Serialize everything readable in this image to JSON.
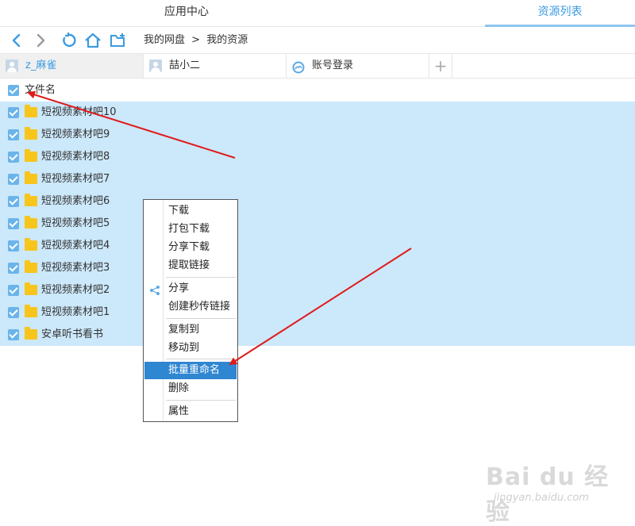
{
  "top_tabs": [
    "应用中心",
    "资源列表"
  ],
  "breadcrumb": {
    "root": "我的网盘",
    "sep": ">",
    "current": "我的资源"
  },
  "accounts": [
    {
      "label": "z_麻雀"
    },
    {
      "label": "喆小二"
    },
    {
      "label": "账号登录"
    },
    {
      "label": "+"
    }
  ],
  "list_header": "文件名",
  "files": [
    "短视频素材吧10",
    "短视频素材吧9",
    "短视频素材吧8",
    "短视频素材吧7",
    "短视频素材吧6",
    "短视频素材吧5",
    "短视频素材吧4",
    "短视频素材吧3",
    "短视频素材吧2",
    "短视频素材吧1",
    "安卓听书看书"
  ],
  "menu": {
    "download": "下载",
    "pack_download": "打包下载",
    "share_download": "分享下载",
    "extract_link": "提取链接",
    "share": "分享",
    "create_flash_link": "创建秒传链接",
    "copy_to": "复制到",
    "move_to": "移动到",
    "batch_rename": "批量重命名",
    "delete": "删除",
    "properties": "属性"
  },
  "watermark": {
    "logo": "Bai du 经验",
    "url": "jingyan.baidu.com"
  },
  "colors": {
    "accent": "#3c9be0",
    "selection": "#cce8fb",
    "menu_highlight": "#2f86d1",
    "folder": "#f7c51c",
    "arrow": "#e01a1a"
  },
  "icons": [
    "back-icon",
    "forward-icon",
    "refresh-icon",
    "home-icon",
    "new-folder-icon",
    "user-avatar-icon",
    "cloud-icon",
    "share-icon",
    "checkbox-icon",
    "folder-icon"
  ]
}
